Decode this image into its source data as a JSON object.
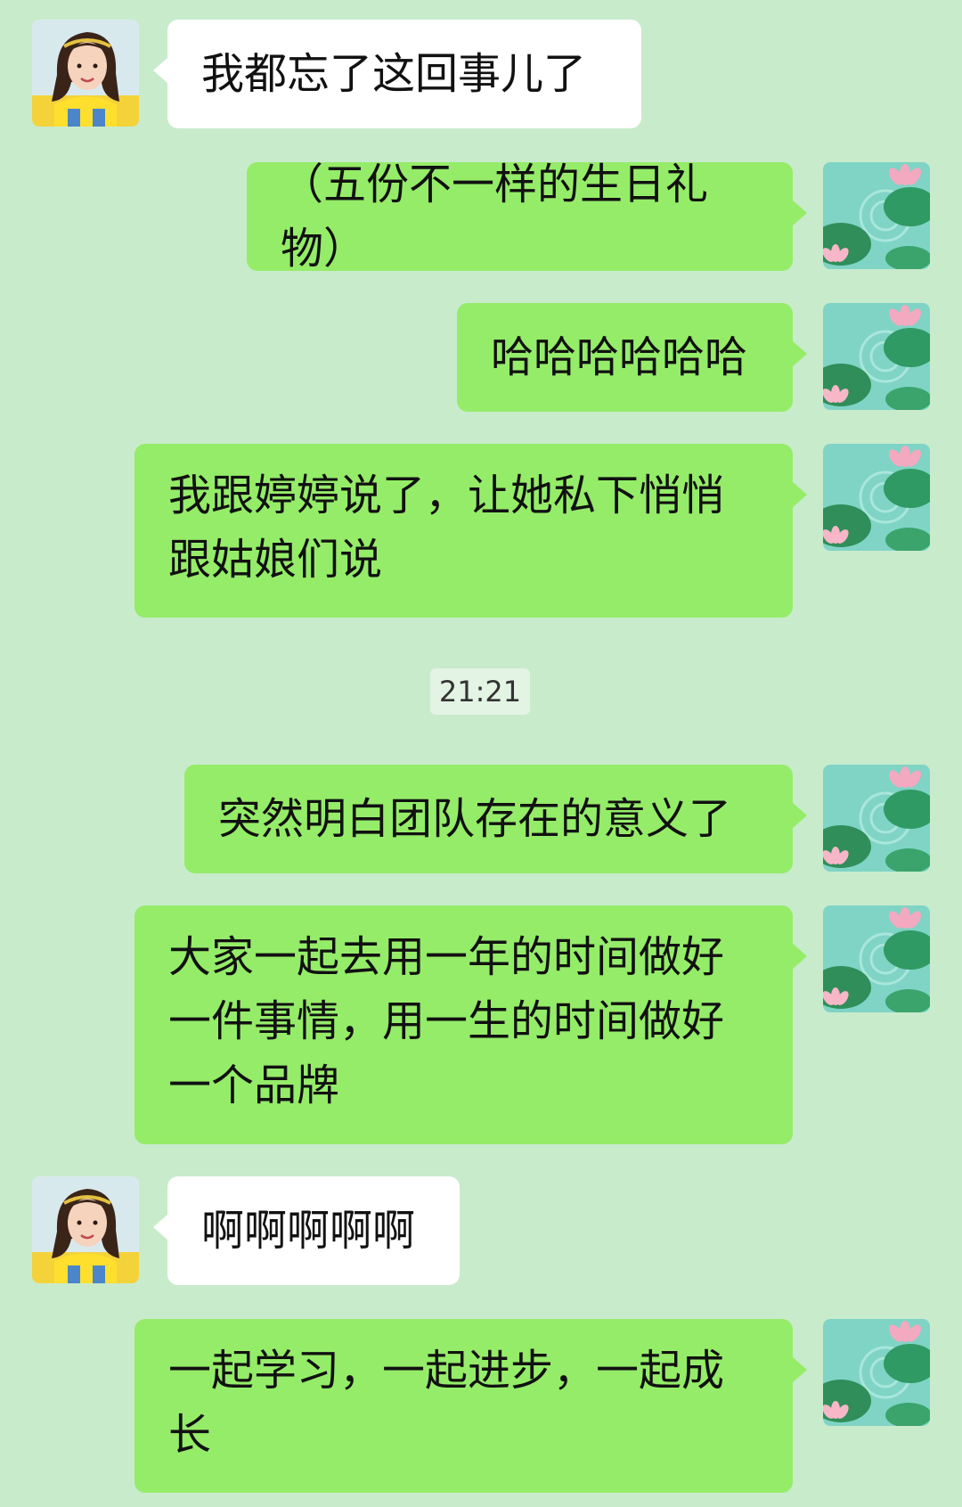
{
  "messages": [
    {
      "sender": "other",
      "avatar": "girl-avatar",
      "text": "我都忘了这回事儿了"
    },
    {
      "sender": "me",
      "avatar": "lotus-avatar",
      "text": "（五份不一样的生日礼物）"
    },
    {
      "sender": "me",
      "avatar": "lotus-avatar",
      "text": "哈哈哈哈哈哈"
    },
    {
      "sender": "me",
      "avatar": "lotus-avatar",
      "text": "我跟婷婷说了，让她私下悄悄跟姑娘们说"
    },
    {
      "sender": "me",
      "avatar": "lotus-avatar",
      "text": "突然明白团队存在的意义了"
    },
    {
      "sender": "me",
      "avatar": "lotus-avatar",
      "text": "大家一起去用一年的时间做好一件事情，用一生的时间做好一个品牌"
    },
    {
      "sender": "other",
      "avatar": "girl-avatar",
      "text": "啊啊啊啊啊"
    },
    {
      "sender": "me",
      "avatar": "lotus-avatar",
      "text": "一起学习，一起进步，一起成长"
    }
  ],
  "timestamp": "21:21",
  "colors": {
    "background": "#c8ebcc",
    "sent_bubble": "#95ec69",
    "received_bubble": "#ffffff"
  }
}
